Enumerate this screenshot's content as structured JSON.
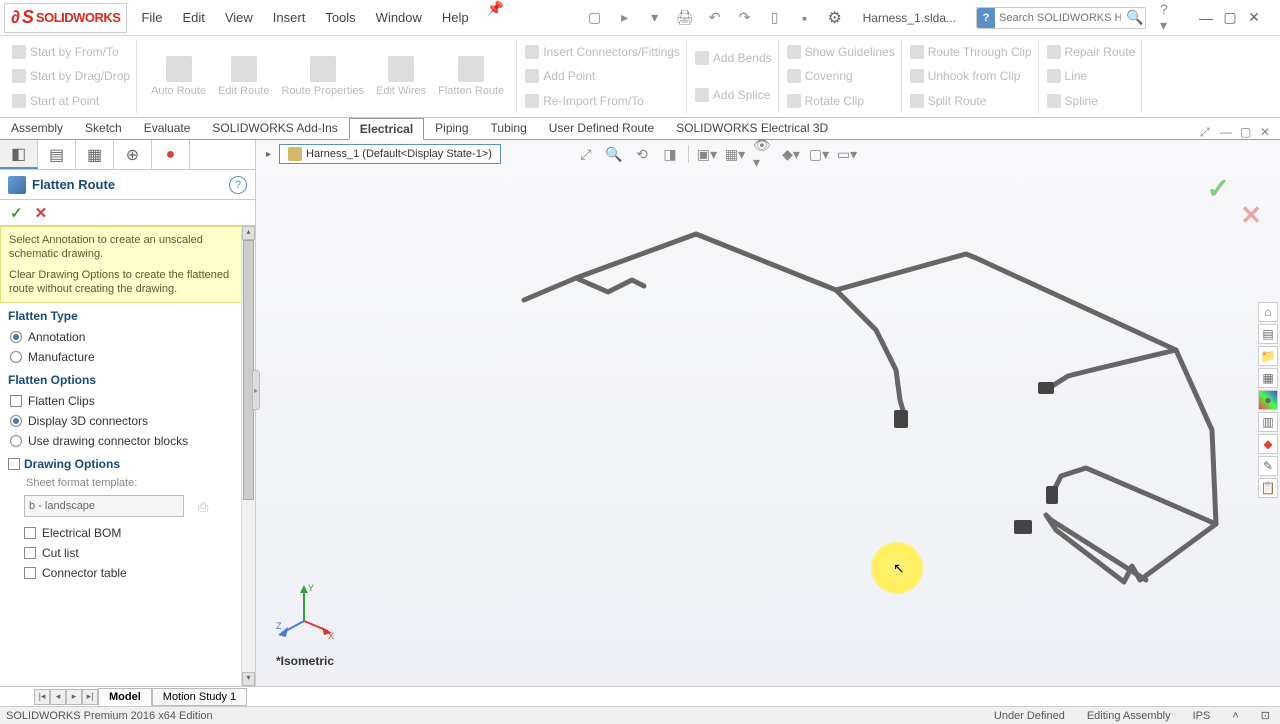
{
  "app": {
    "logo_prefix": "S",
    "logo_text": "SOLIDWORKS"
  },
  "menu": {
    "file": "File",
    "edit": "Edit",
    "view": "View",
    "insert": "Insert",
    "tools": "Tools",
    "window": "Window",
    "help": "Help"
  },
  "title": {
    "doc_name": "Harness_1.slda...",
    "search_placeholder": "Search SOLIDWORKS Help"
  },
  "ribbon": {
    "start_from_to": "Start by From/To",
    "start_drag_drop": "Start by Drag/Drop",
    "start_at_point": "Start at Point",
    "auto_route": "Auto Route",
    "edit_route": "Edit Route",
    "route_properties": "Route Properties",
    "edit_wires": "Edit Wires",
    "flatten_route": "Flatten Route",
    "insert_connectors": "Insert Connectors/Fittings",
    "add_point": "Add Point",
    "reimport": "Re-Import From/To",
    "add_bends": "Add Bends",
    "add_splice": "Add Splice",
    "show_guidelines": "Show Guidelines",
    "covering": "Covering",
    "rotate_clip": "Rotate Clip",
    "route_through_clip": "Route Through Clip",
    "unhook_clip": "Unhook from Clip",
    "split_route": "Split Route",
    "repair_route": "Repair Route",
    "line": "Line",
    "spline": "Spline"
  },
  "tabs": {
    "assembly": "Assembly",
    "sketch": "Sketch",
    "evaluate": "Evaluate",
    "addins": "SOLIDWORKS Add-Ins",
    "electrical": "Electrical",
    "piping": "Piping",
    "tubing": "Tubing",
    "udr": "User Defined Route",
    "elec3d": "SOLIDWORKS Electrical 3D"
  },
  "breadcrumb": {
    "label": "Harness_1 (Default<Display State-1>)"
  },
  "pm": {
    "title": "Flatten Route",
    "msg1": "Select Annotation to create an unscaled schematic drawing.",
    "msg2": "Clear Drawing Options to create the flattened route without creating the drawing.",
    "sec_flatten_type": "Flatten Type",
    "opt_annotation": "Annotation",
    "opt_manufacture": "Manufacture",
    "sec_flatten_options": "Flatten Options",
    "opt_flatten_clips": "Flatten Clips",
    "opt_display_3d": "Display 3D connectors",
    "opt_use_blocks": "Use drawing connector blocks",
    "sec_drawing_options": "Drawing Options",
    "sheet_format_label": "Sheet format template:",
    "sheet_format_value": "b - landscape",
    "opt_ebom": "Electrical BOM",
    "opt_cut_list": "Cut list",
    "opt_conn_table": "Connector table"
  },
  "canvas": {
    "iso_label": "*Isometric"
  },
  "bottom": {
    "model": "Model",
    "motion": "Motion Study 1"
  },
  "status": {
    "edition": "SOLIDWORKS Premium 2016 x64 Edition",
    "under_defined": "Under Defined",
    "editing": "Editing Assembly",
    "units": "IPS"
  }
}
